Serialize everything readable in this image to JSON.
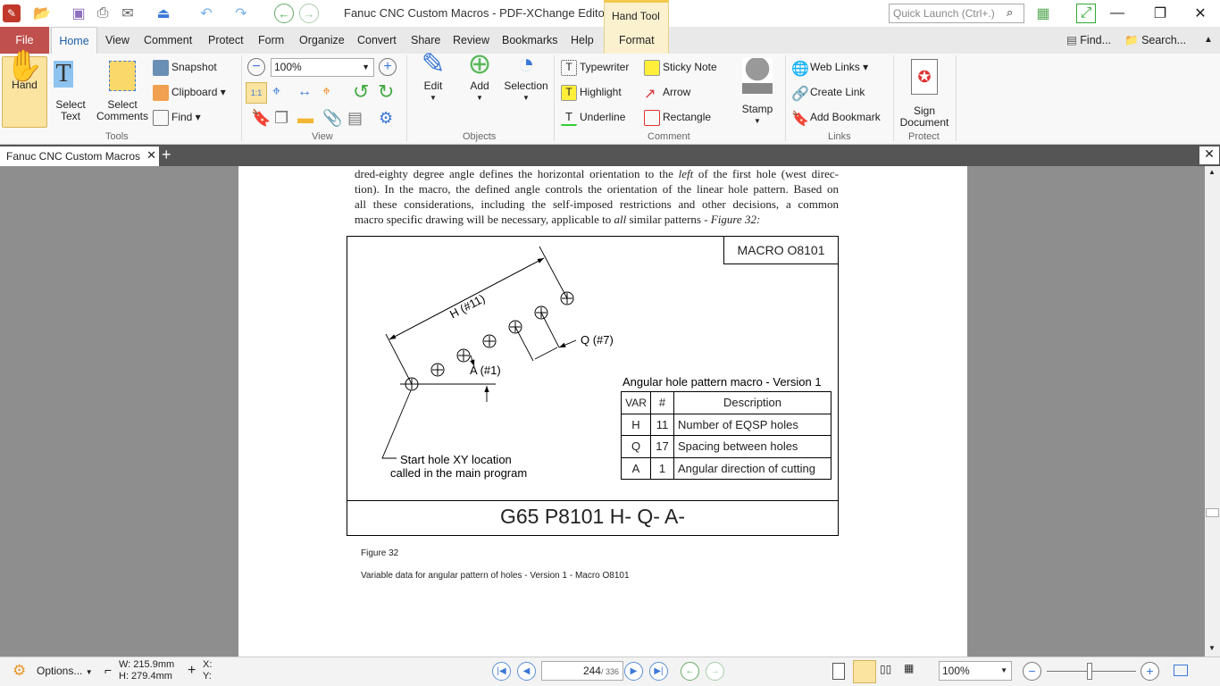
{
  "app": {
    "title": "Fanuc CNC Custom Macros - PDF-XChange Editor",
    "context_tab_group": "Hand Tool",
    "quick_launch_placeholder": "Quick Launch (Ctrl+.)"
  },
  "menu_tabs": [
    "File",
    "Home",
    "View",
    "Comment",
    "Protect",
    "Form",
    "Organize",
    "Convert",
    "Share",
    "Review",
    "Bookmarks",
    "Help",
    "Format"
  ],
  "menu_right": {
    "find": "Find...",
    "search": "Search..."
  },
  "ribbon": {
    "tools": {
      "label": "Tools",
      "hand": "Hand",
      "select_text": [
        "Select",
        "Text"
      ],
      "select_comments": [
        "Select",
        "Comments"
      ],
      "snapshot": "Snapshot",
      "clipboard": "Clipboard",
      "find": "Find"
    },
    "view": {
      "label": "View",
      "zoom": "100%"
    },
    "objects": {
      "label": "Objects",
      "edit": "Edit",
      "add": "Add",
      "selection": "Selection"
    },
    "comment": {
      "label": "Comment",
      "typewriter": "Typewriter",
      "sticky_note": "Sticky Note",
      "highlight": "Highlight",
      "arrow": "Arrow",
      "underline": "Underline",
      "rectangle": "Rectangle",
      "stamp": "Stamp"
    },
    "links": {
      "label": "Links",
      "web_links": "Web Links",
      "create_link": "Create Link",
      "add_bookmark": "Add Bookmark"
    },
    "protect": {
      "label": "Protect",
      "sign": [
        "Sign",
        "Document"
      ]
    }
  },
  "document_tab": "Fanuc CNC Custom Macros",
  "page": {
    "paragraph_lines": [
      "dred-eighty degree angle defines the horizontal orientation to the <i>left</i> of the first hole (west direc-",
      "tion). In the macro, the defined angle controls the orientation of the linear hole pattern. Based on",
      "all these considerations, including the self-imposed restrictions and other decisions, a common",
      "macro specific drawing will be necessary, applicable to <i>all</i> similar patterns - <i>Figure 32:</i>"
    ],
    "figure": {
      "macro_label": "MACRO O8101",
      "h_label": "H (#11)",
      "q_label": "Q (#7)",
      "a_label": "A (#1)",
      "start_label": [
        "Start hole XY location",
        "called in the main program"
      ],
      "table_title": "Angular hole pattern macro - Version 1",
      "table_headers": [
        "VAR",
        "#",
        "Description"
      ],
      "table_rows": [
        [
          "H",
          "11",
          "Number of EQSP holes"
        ],
        [
          "Q",
          "17",
          "Spacing between holes"
        ],
        [
          "A",
          "1",
          "Angular direction of cutting"
        ]
      ],
      "code": "G65 P8101 H- Q- A-"
    },
    "caption_num": "Figure 32",
    "caption_text": "Variable data for angular pattern of holes - Version 1 - Macro O8101"
  },
  "status": {
    "options": "Options...",
    "width": "W: 215.9mm",
    "height": "H: 279.4mm",
    "x": "X:",
    "y": "Y:",
    "current_page": "244",
    "total_pages": "/ 336",
    "zoom": "100%",
    "zoom_level_percent": 100
  }
}
